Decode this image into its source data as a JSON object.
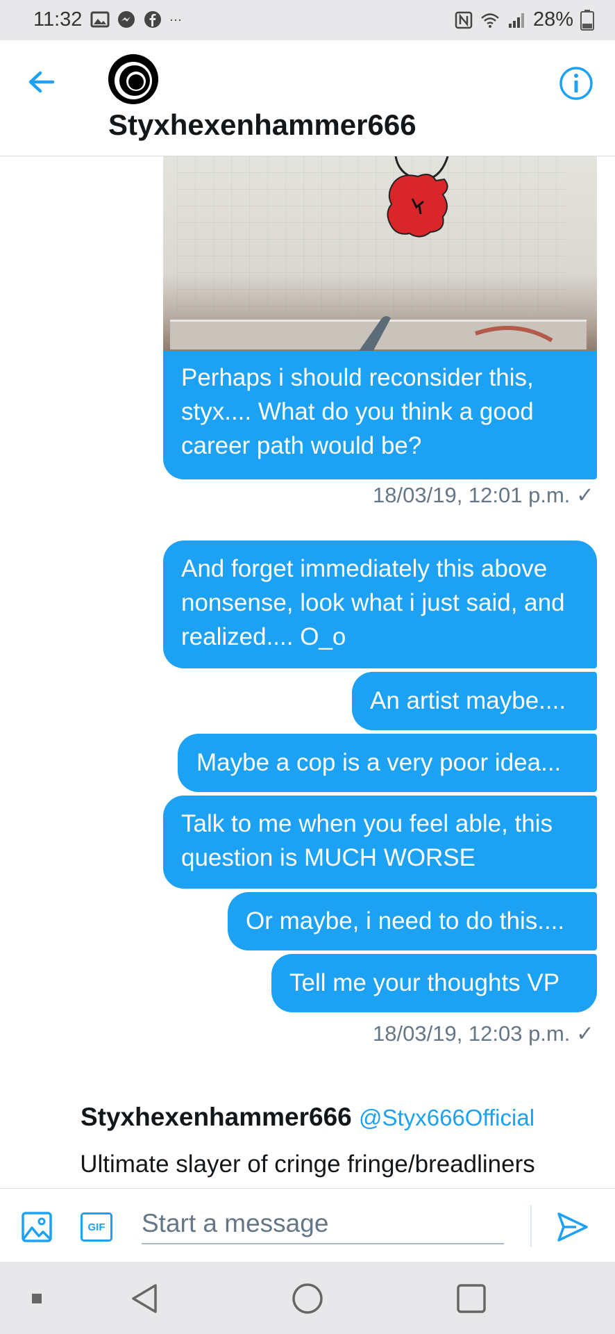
{
  "status_bar": {
    "time": "11:32",
    "battery": "28%",
    "overflow": "···"
  },
  "header": {
    "title": "Styxhexenhammer666"
  },
  "messages": [
    {
      "text": "Perhaps i should reconsider this, styx.... What do you think a good career path would be?"
    },
    {
      "text": "And forget immediately this above nonsense, look what i just said, and realized.... O_o"
    },
    {
      "text": "An artist maybe...."
    },
    {
      "text": "Maybe a cop is a very poor idea..."
    },
    {
      "text": "Talk to me when you feel able, this question is MUCH WORSE"
    },
    {
      "text": "Or maybe, i need to do this...."
    },
    {
      "text": "Tell me your thoughts VP"
    }
  ],
  "timestamps": [
    "18/03/19, 12:01 p.m. ✓",
    "18/03/19, 12:03 p.m. ✓"
  ],
  "profile": {
    "name": "Styxhexenhammer666",
    "handle": "@Styx666Official",
    "bio": "Ultimate slayer of cringe fringe/breadliners"
  },
  "composer": {
    "placeholder": "Start a message",
    "gif_label": "GIF"
  },
  "colors": {
    "accent": "#1da1f2",
    "bubble_text": "#ffffff",
    "muted": "#657786"
  }
}
